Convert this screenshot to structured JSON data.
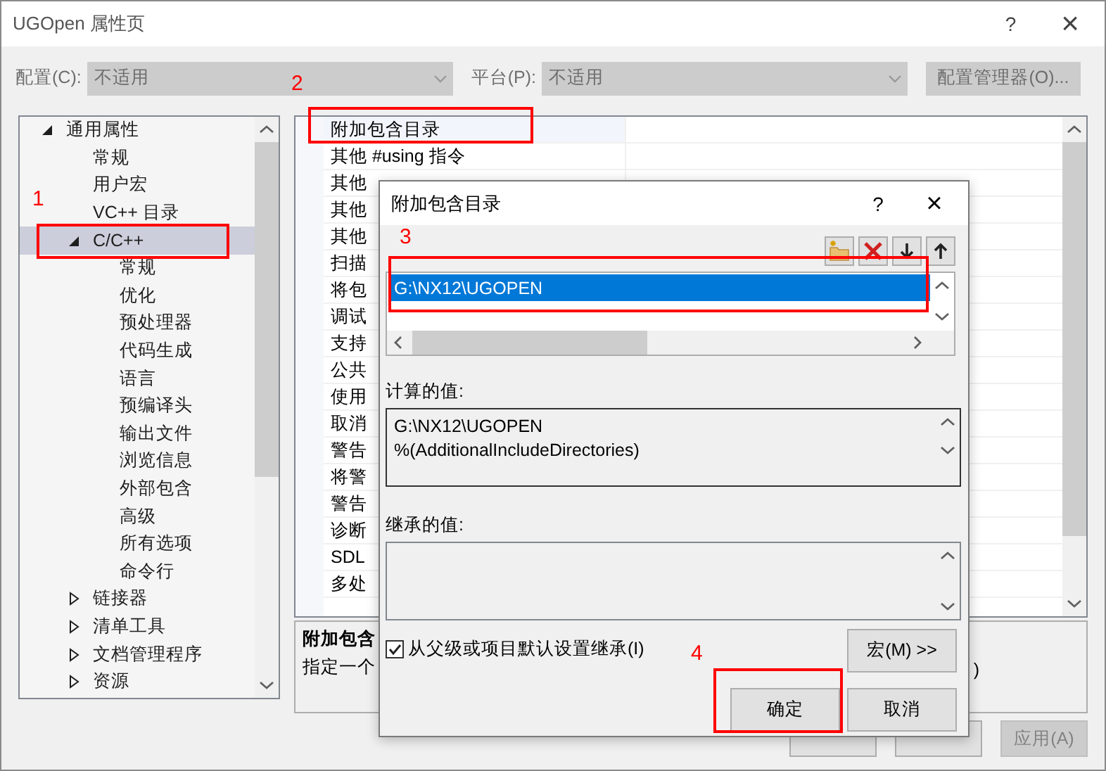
{
  "window": {
    "title": "UGOpen 属性页",
    "help": "?",
    "close": "×"
  },
  "config": {
    "label": "配置(C):",
    "value": "不适用",
    "disabled": true
  },
  "platform": {
    "label": "平台(P):",
    "value": "不适用",
    "disabled": true
  },
  "config_manager_button": {
    "label": "配置管理器(O)...",
    "disabled": true
  },
  "tree": [
    {
      "label": "通用属性",
      "expanded": true,
      "selected": false,
      "children": [
        {
          "label": "常规",
          "selected": false
        },
        {
          "label": "用户宏",
          "selected": false
        },
        {
          "label": "VC++ 目录",
          "selected": false
        },
        {
          "label": "C/C++",
          "expanded": true,
          "selected": true,
          "children": [
            {
              "label": "常规",
              "selected": false
            },
            {
              "label": "优化",
              "selected": false
            },
            {
              "label": "预处理器",
              "selected": false
            },
            {
              "label": "代码生成",
              "selected": false
            },
            {
              "label": "语言",
              "selected": false
            },
            {
              "label": "预编译头",
              "selected": false
            },
            {
              "label": "输出文件",
              "selected": false
            },
            {
              "label": "浏览信息",
              "selected": false
            },
            {
              "label": "外部包含",
              "selected": false
            },
            {
              "label": "高级",
              "selected": false
            },
            {
              "label": "所有选项",
              "selected": false
            },
            {
              "label": "命令行",
              "selected": false
            }
          ]
        },
        {
          "label": "链接器",
          "expanded": false,
          "selected": false
        },
        {
          "label": "清单工具",
          "expanded": false,
          "selected": false
        },
        {
          "label": "文档管理程序",
          "expanded": false,
          "selected": false
        },
        {
          "label": "资源",
          "expanded": false,
          "selected": false
        }
      ]
    }
  ],
  "properties": [
    {
      "name": "附加包含目录",
      "selected": true
    },
    {
      "name": "其他 #using 指令",
      "selected": false
    },
    {
      "name": "其他",
      "selected": false
    },
    {
      "name": "其他",
      "selected": false
    },
    {
      "name": "其他",
      "selected": false
    },
    {
      "name": "扫描",
      "selected": false
    },
    {
      "name": "将包",
      "selected": false
    },
    {
      "name": "调试",
      "selected": false
    },
    {
      "name": "支持",
      "selected": false
    },
    {
      "name": "公共",
      "selected": false
    },
    {
      "name": "使用",
      "selected": false
    },
    {
      "name": "取消",
      "selected": false
    },
    {
      "name": "警告",
      "selected": false
    },
    {
      "name": "将警",
      "selected": false
    },
    {
      "name": "警告",
      "selected": false
    },
    {
      "name": "诊断",
      "selected": false
    },
    {
      "name": "SDL",
      "selected": false
    },
    {
      "name": "多处",
      "selected": false
    }
  ],
  "description": {
    "title": "附加包含",
    "text": "指定一个",
    "tail": ")"
  },
  "buttons": [
    {
      "disabled": false
    },
    {
      "disabled": false
    },
    {
      "label": "应用(A)",
      "disabled": true
    }
  ],
  "dialog": {
    "title": "附加包含目录",
    "help": "?",
    "close": "×",
    "tools": [
      {
        "kind": "new-folder"
      },
      {
        "kind": "delete"
      },
      {
        "kind": "down"
      },
      {
        "kind": "up"
      }
    ],
    "entries": [
      {
        "text": "G:\\NX12\\UGOPEN",
        "selected": true
      }
    ],
    "evaluated_label": "计算的值:",
    "evaluated": [
      "G:\\NX12\\UGOPEN",
      "%(AdditionalIncludeDirectories)"
    ],
    "inherited_label": "继承的值:",
    "inherit": {
      "label": "从父级或项目默认设置继承(I)",
      "checked": true
    },
    "macros_button": "宏(M) >>",
    "ok": "确定",
    "cancel": "取消"
  },
  "annotations": [
    {
      "label": "1"
    },
    {
      "label": "2"
    },
    {
      "label": "3"
    },
    {
      "label": "4"
    }
  ]
}
